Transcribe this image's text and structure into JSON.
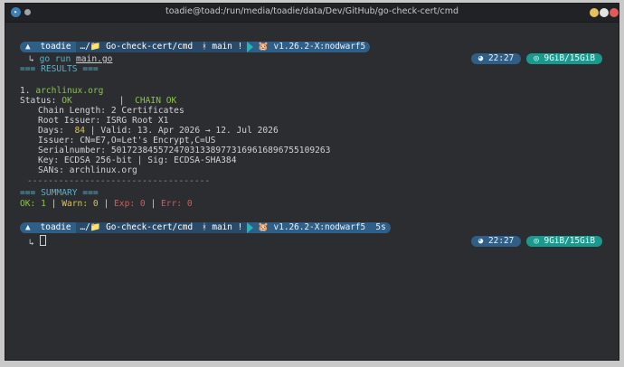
{
  "window": {
    "title": "toadie@toad:/run/media/toadie/data/Dev/GitHub/go-check-cert/cmd",
    "app_icon": "konsole-icon"
  },
  "prompt1": {
    "os": "▲",
    "user": "toadie",
    "path": "…/📁 Go-check-cert/cmd",
    "git": "ᚼ main !",
    "env": "🐹 v1.26.2-X:nodwarf5",
    "time": "◕ 22:27",
    "mem": "◎ 9GiB/15GiB"
  },
  "command": {
    "prefix": "↳",
    "text": "go run ",
    "arg": "main.go"
  },
  "results": {
    "header": "=== RESULTS ===",
    "index": "1.",
    "host": "archlinux.org",
    "status_label": "Status:",
    "status_value": "OK",
    "sep": "|",
    "chain_value": "CHAIN OK",
    "chain_length": "Chain Length: 2 Certificates",
    "root_issuer": "Root Issuer: ISRG Root X1",
    "days_label": "Days:",
    "days_value": "84",
    "valid_range": "| Valid: 13. Apr 2026 → 12. Jul 2026",
    "issuer": "Issuer: CN=E7,O=Let's Encrypt,C=US",
    "serial": "Serialnumber: 501723845572470313389773169616896755109263",
    "key": "Key: ECDSA 256-bit | Sig: ECDSA-SHA384",
    "sans": "SANs: archlinux.org",
    "divider": "-----------------------------------"
  },
  "summary": {
    "header": "=== SUMMARY ===",
    "ok": "OK: 1",
    "warn": "Warn: 0",
    "exp": "Exp: 0",
    "err": "Err: 0",
    "pipe": "|"
  },
  "prompt2": {
    "os": "▲",
    "user": "toadie",
    "path": "…/📁 Go-check-cert/cmd",
    "git": "ᚼ main !",
    "env": "🐹 v1.26.2-X:nodwarf5  5s",
    "time": "◕ 22:27",
    "mem": "◎ 9GiB/15GiB",
    "cursor_prefix": "↳"
  }
}
